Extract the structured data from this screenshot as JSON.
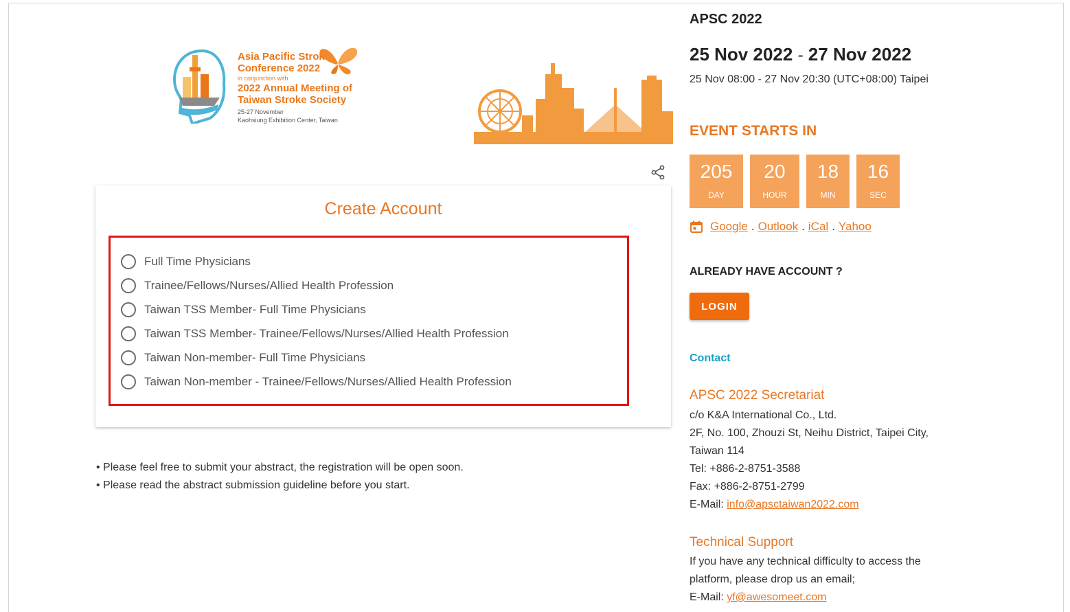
{
  "banner": {
    "logo_title": "Asia Pacific Stroke Conference 2022",
    "logo_conjunction": "in conjunction with",
    "logo_meeting": "2022 Annual Meeting of Taiwan Stroke Society",
    "logo_date": "25-27 November",
    "logo_venue": "Kaohsiung Exhibition Center, Taiwan"
  },
  "card": {
    "title": "Create Account",
    "options": [
      "Full Time Physicians",
      "Trainee/Fellows/Nurses/Allied Health Profession",
      "Taiwan TSS Member- Full Time Physicians",
      "Taiwan TSS Member- Trainee/Fellows/Nurses/Allied Health Profession",
      "Taiwan Non-member- Full Time Physicians",
      "Taiwan Non-member - Trainee/Fellows/Nurses/Allied Health Profession"
    ]
  },
  "notes": [
    "• Please feel free to submit your abstract, the registration will be open soon.",
    "• Please read the abstract submission guideline before you start."
  ],
  "event": {
    "name": "APSC 2022",
    "start_date": "25 Nov 2022",
    "date_separator": "-",
    "end_date": "27 Nov 2022",
    "time_range": "25 Nov 08:00 - 27 Nov 20:30 (UTC+08:00) Taipei",
    "starts_in_label": "EVENT STARTS IN",
    "countdown": [
      {
        "value": "205",
        "unit": "DAY"
      },
      {
        "value": "20",
        "unit": "HOUR"
      },
      {
        "value": "18",
        "unit": "MIN"
      },
      {
        "value": "16",
        "unit": "SEC"
      }
    ],
    "calendars": [
      "Google",
      "Outlook",
      "iCal",
      "Yahoo"
    ],
    "calendar_separator": "."
  },
  "account": {
    "already_label": "ALREADY HAVE ACCOUNT ?",
    "login_label": "LOGIN"
  },
  "contact": {
    "label": "Contact",
    "secretariat_title": "APSC 2022 Secretariat",
    "company": "c/o K&A International Co., Ltd.",
    "address": "2F, No. 100, Zhouzi St, Neihu District, Taipei City, Taiwan 114",
    "tel": "Tel: +886-2-8751-3588",
    "fax": "Fax: +886-2-8751-2799",
    "email_label": "E-Mail: ",
    "email": "info@apsctaiwan2022.com",
    "support_title": "Technical Support",
    "support_text": "If you have any technical difficulty to access the platform, please drop us an email;",
    "support_email_label": "E-Mail: ",
    "support_email": "yf@awesomeet.com"
  },
  "colors": {
    "accent": "#e87722",
    "countdown_bg": "#f5a25a",
    "login_bg": "#ee6c0d",
    "contact": "#19a0c8",
    "highlight": "#e11414"
  }
}
